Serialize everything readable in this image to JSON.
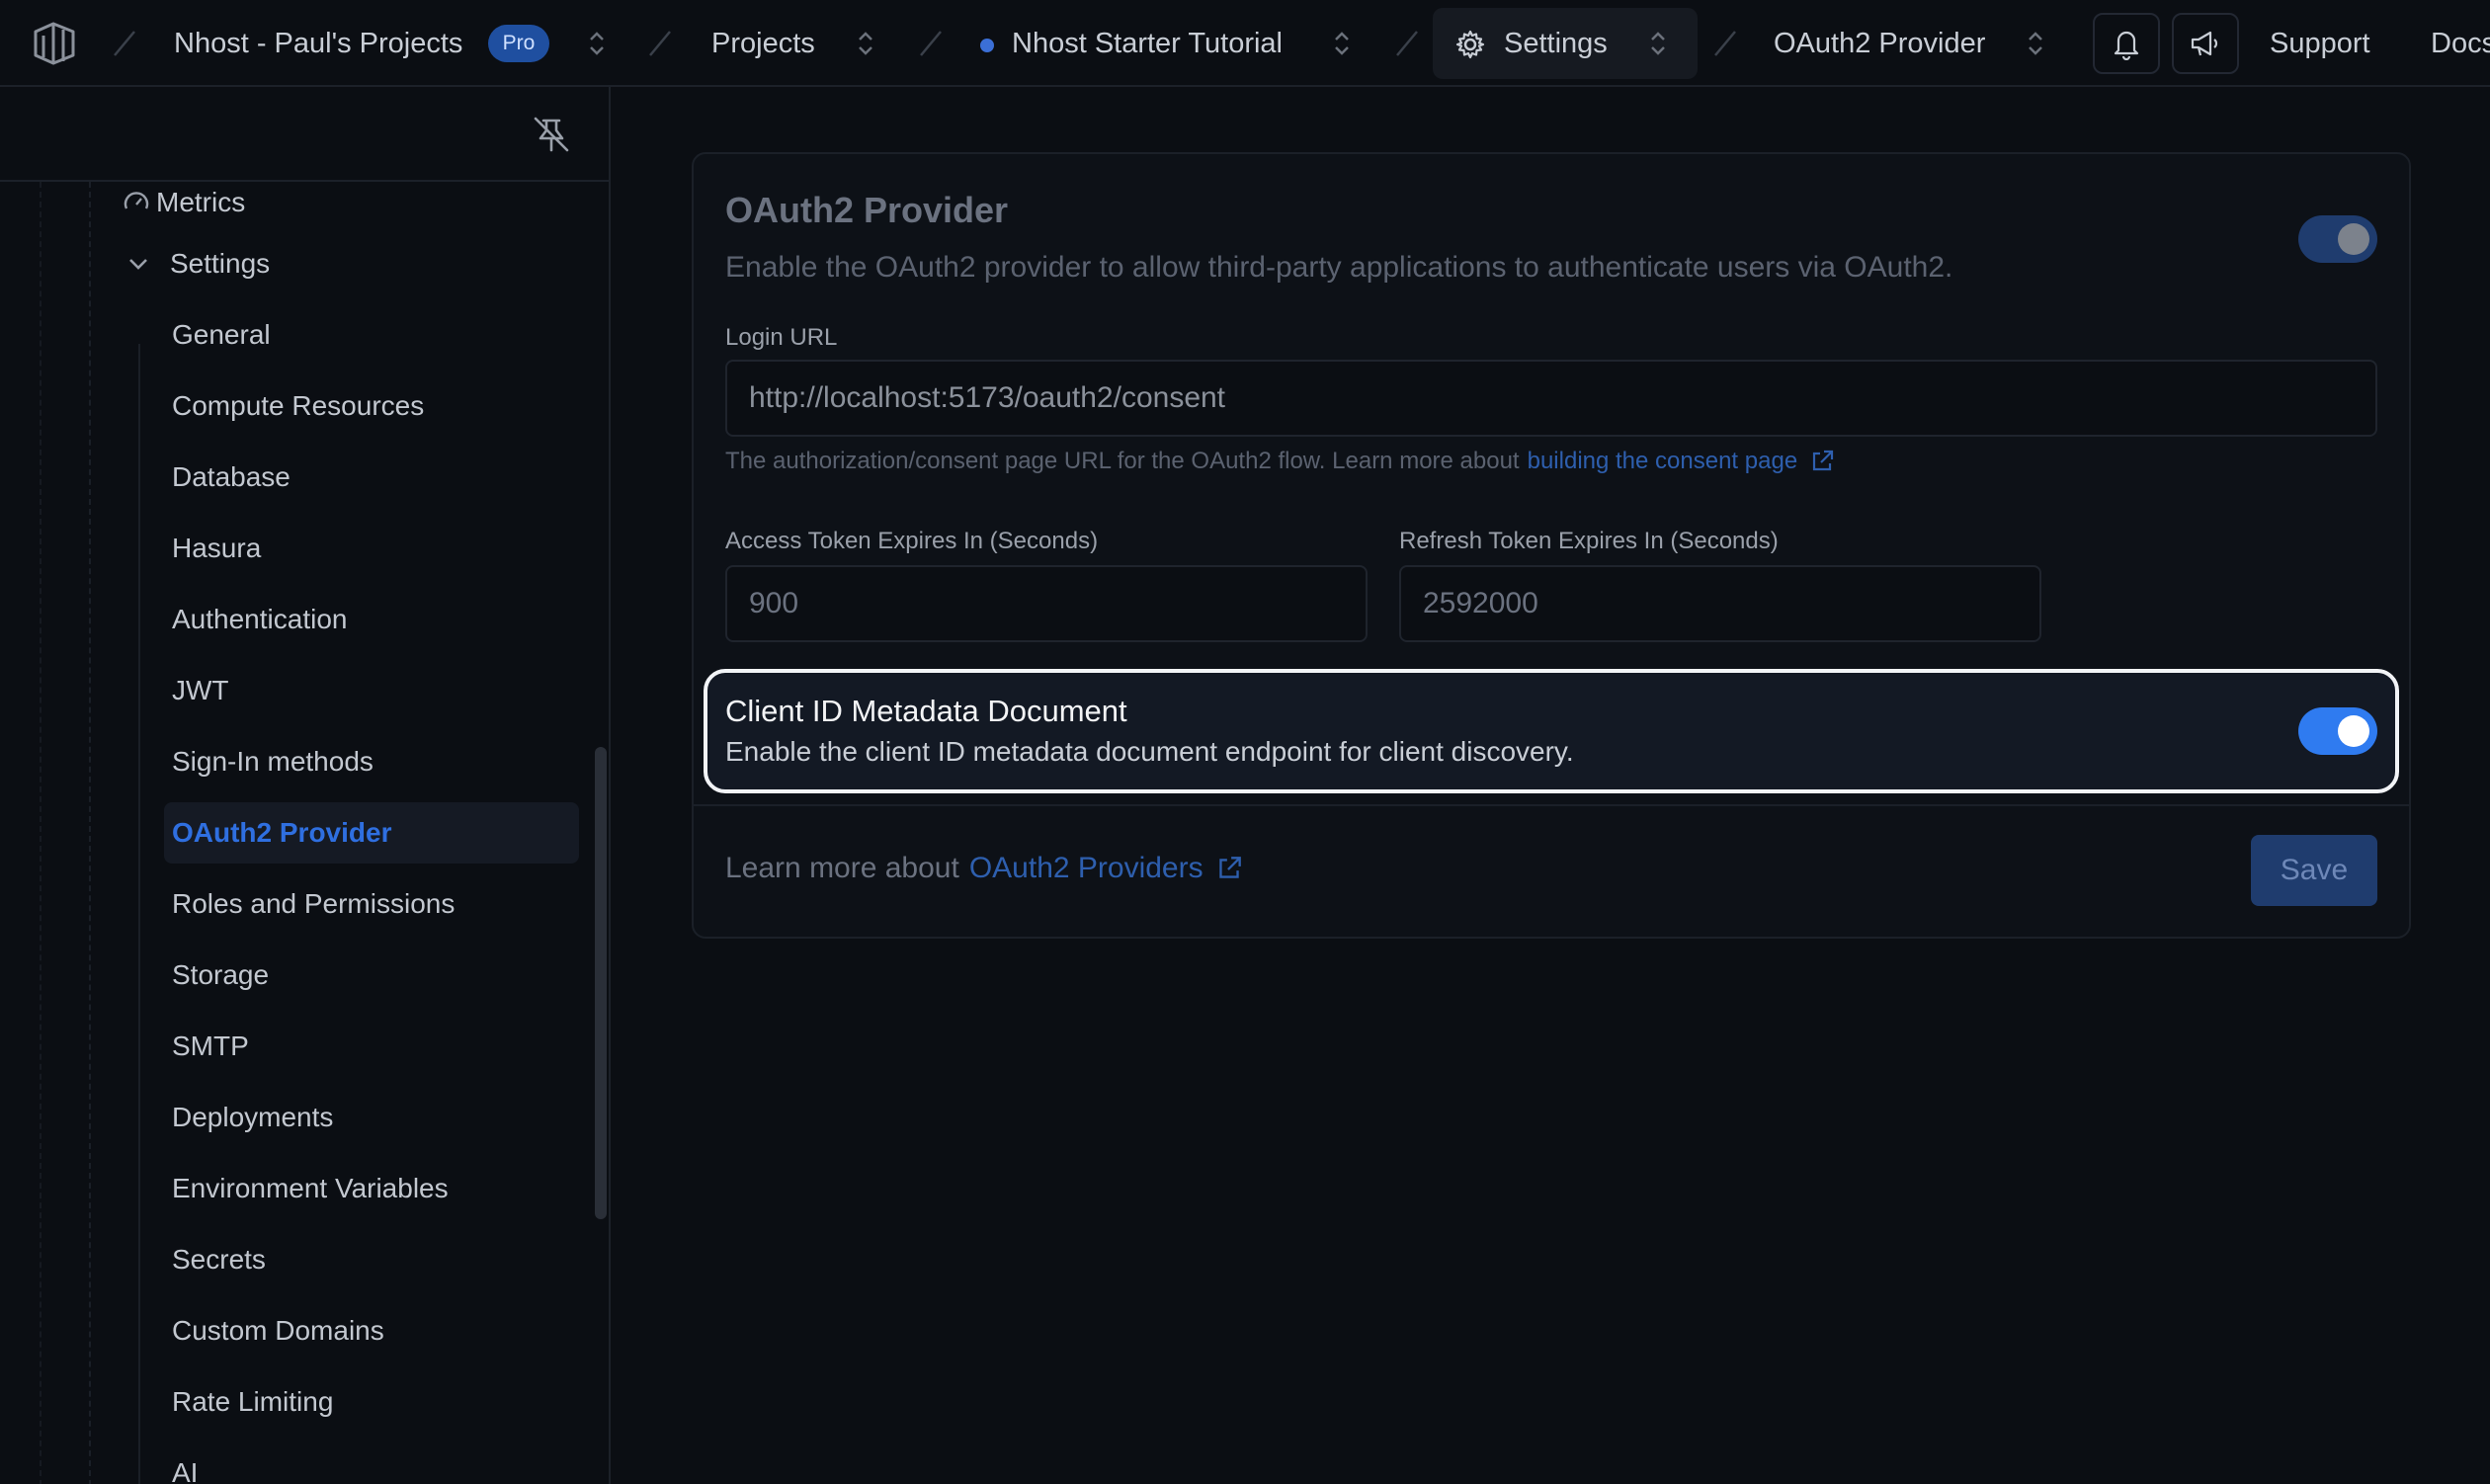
{
  "topbar": {
    "org_name": "Nhost - Paul's Projects",
    "org_badge": "Pro",
    "projects_label": "Projects",
    "project_name": "Nhost Starter Tutorial",
    "settings_label": "Settings",
    "page_label": "OAuth2 Provider",
    "support_label": "Support",
    "docs_label": "Docs"
  },
  "sidebar": {
    "metrics_label": "Metrics",
    "settings_label": "Settings",
    "items": [
      {
        "label": "General"
      },
      {
        "label": "Compute Resources"
      },
      {
        "label": "Database"
      },
      {
        "label": "Hasura"
      },
      {
        "label": "Authentication"
      },
      {
        "label": "JWT"
      },
      {
        "label": "Sign-In methods"
      },
      {
        "label": "OAuth2 Provider"
      },
      {
        "label": "Roles and Permissions"
      },
      {
        "label": "Storage"
      },
      {
        "label": "SMTP"
      },
      {
        "label": "Deployments"
      },
      {
        "label": "Environment Variables"
      },
      {
        "label": "Secrets"
      },
      {
        "label": "Custom Domains"
      },
      {
        "label": "Rate Limiting"
      },
      {
        "label": "AI"
      }
    ],
    "active_item": "OAuth2 Provider"
  },
  "card": {
    "title": "OAuth2 Provider",
    "description": "Enable the OAuth2 provider to allow third-party applications to authenticate users via OAuth2.",
    "enabled": true,
    "login_url_label": "Login URL",
    "login_url_value": "http://localhost:5173/oauth2/consent",
    "login_url_help": "The authorization/consent page URL for the OAuth2 flow. Learn more about",
    "login_url_help_link": "building the consent page",
    "access_token_label": "Access Token Expires In (Seconds)",
    "access_token_value": "900",
    "refresh_token_label": "Refresh Token Expires In (Seconds)",
    "refresh_token_value": "2592000",
    "metadata_title": "Client ID Metadata Document",
    "metadata_description": "Enable the client ID metadata document endpoint for client discovery.",
    "metadata_enabled": true,
    "learn_more_prefix": "Learn more about",
    "learn_more_link": "OAuth2 Providers",
    "save_label": "Save"
  },
  "colors": {
    "accent": "#2f6fe0",
    "toggle_on": "#2f7bf0",
    "background": "#0b0e13"
  }
}
